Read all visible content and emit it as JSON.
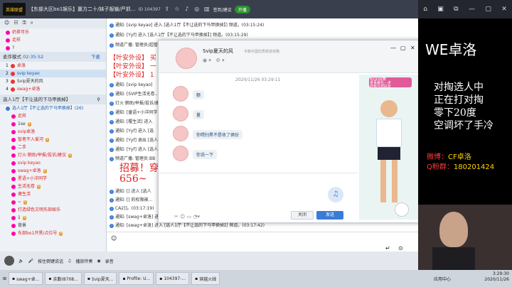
{
  "topbar": {
    "logo_text": "英雄联盟",
    "room_title": "【东部大区bo1娱乐】赢方二十/妹子报输/严抓...",
    "room_id": "ID 104397",
    "nav_icons": [
      "share-icon",
      "star-icon",
      "bell-icon",
      "globe-icon"
    ],
    "checkin_label": "签到/建议",
    "open_label": "开播"
  },
  "rightnav": [
    "home-icon",
    "chat-icon",
    "copy-icon",
    "minimize-icon",
    "restore-icon",
    "close-icon"
  ],
  "leftpanel": {
    "top_users": [
      {
        "name": "奶茶可乐",
        "color": "#d22"
      },
      {
        "name": "走样",
        "color": "#d22"
      },
      {
        "name": "?",
        "color": "#333"
      }
    ],
    "queue_label": "麦序模式",
    "queue_time": "02:35:52",
    "queue_action": "下麦",
    "queue_users": [
      {
        "idx": "1",
        "name": "卓洛",
        "color": "#d22"
      },
      {
        "idx": "2",
        "name": "svip keyao",
        "color": "#1a5fb4",
        "hl": true
      },
      {
        "idx": "3",
        "name": "Svip夏天的风",
        "color": "#333"
      },
      {
        "idx": "4",
        "name": "swag+卓洛",
        "color": "#d22"
      }
    ],
    "channel_title": "选人1厅【不让选的下马甲换掉】",
    "channel_users": [
      {
        "name": "选人1厅【不让选的下马甲换掉】(26)",
        "color": "#1a5fb4"
      },
      {
        "name": "走样",
        "color": "#d22"
      },
      {
        "name": "1se",
        "color": "#333"
      },
      {
        "name": "svip卓洛",
        "color": "#d22"
      },
      {
        "name": "智者不入爱河",
        "color": "#d22"
      },
      {
        "name": "二手",
        "color": "#d22"
      },
      {
        "name": "灯火·鹅助/举报/投诉/建议",
        "color": "#d22"
      },
      {
        "name": "svip keyao",
        "color": "#d22"
      },
      {
        "name": "swag+卓洛",
        "color": "#d22"
      },
      {
        "name": "星语+小洋同学",
        "color": "#d22"
      },
      {
        "name": "生活无卷",
        "color": "#d22"
      },
      {
        "name": "傻生活",
        "color": "#d22"
      },
      {
        "name": "~",
        "color": "#333"
      },
      {
        "name": "打造绿色文明东部娱乐",
        "color": "#d22"
      },
      {
        "name": "1",
        "color": "#333"
      },
      {
        "name": "背景",
        "color": "#333"
      },
      {
        "name": "东部bo1开黑/点位号",
        "color": "#d22"
      }
    ]
  },
  "chat": {
    "lines": [
      "通知: [svip keyao] 进入 [选人1厅【不让选的下马甲换掉】] 频道。(03:15:24)",
      "通知: [Yyf] 进入 [选人1厅【不让选的下马甲换掉】] 频道。(03:15:29)",
      "频道广播: 管理员/超管..."
    ],
    "promo1": "【叶安外设】 买",
    "promo2": "【叶安外设】 一",
    "promo3": "【叶安外设】 1",
    "more_lines": [
      "通知: [svip keyao]",
      "通知: [SVIP生活无卷...",
      "灯火·鹅助/举报/投诉/建议",
      "通知: [童语+小洋同学",
      "通知: [樱生活] 进入",
      "通知: [Yyf] 进入 [选",
      "通知: [Yyf] 退出 [选人",
      "通知: [Yyf] 进入 [选人",
      "频道广播: 管理员:BB"
    ],
    "recruit": "招募！穿",
    "recruit_num": "656~",
    "after_lines": [
      "通知: [] 进入 [选人",
      "通知: [] 的权限被...",
      "CA2]]。(03:17:19)",
      "通知: [swag+卓洛] 进",
      "通知: [swag+卓洛] 进入 [选人1厅【不让选的下马甲换掉】] 频道。(03:17:42)"
    ],
    "input_placeholder": ""
  },
  "pm": {
    "name": "Svip夏天的风",
    "subtitle": "半数中国优质频道攻略",
    "date": "2020/11/26 03:29:11",
    "messages": [
      "额",
      "量",
      "你喂扫黑不是收了俩份",
      "你说一下"
    ],
    "close_label": "关闭",
    "send_label": "发送",
    "avatar_caption": "玩QQ炫舞\n身事美化—步\n你我互结好友"
  },
  "right": {
    "brand_prefix": "WE",
    "brand_name": "卓洛",
    "poem": [
      "对掏选人中",
      "正在打对掏",
      "零下20度",
      "空调坏了手冷"
    ],
    "weibo_label": "微博：",
    "weibo_value": "CF卓洛",
    "qq_label": "Q粉群：",
    "qq_value": "180201424"
  },
  "toolbar": {
    "tb1_items": [
      "按住倒键说话",
      "播放伴奏",
      "录音"
    ],
    "tasks": [
      "swag+卓...",
      "余勤(8708...",
      "Svip夏天...",
      "Profile: U...",
      "104397-...",
      "穿越火线"
    ],
    "clock_time": "3:29:30",
    "clock_date": "2020/11/26",
    "apply_label": "应用中心"
  }
}
